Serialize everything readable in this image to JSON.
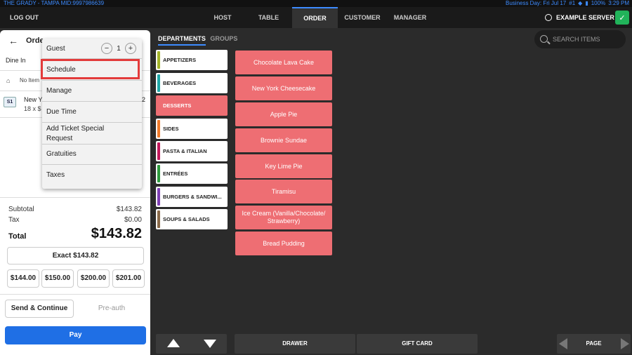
{
  "status_bar": {
    "left": "THE GRADY - TAMPA  MID:9997986639",
    "business_day": "Business Day: Fri Jul 17",
    "number": "#1",
    "battery": "100%",
    "time": "3:29 PM"
  },
  "nav": {
    "logout": "LOG OUT",
    "tabs": [
      {
        "label": "HOST"
      },
      {
        "label": "TABLE"
      },
      {
        "label": "ORDER"
      },
      {
        "label": "CUSTOMER"
      },
      {
        "label": "MANAGER"
      }
    ],
    "active_tab": "ORDER",
    "server_name": "EXAMPLE SERVER"
  },
  "order_panel": {
    "title": "Orde",
    "dine_in": "Dine In",
    "no_item": "No Item",
    "seat": "S1",
    "item_name": "New Y",
    "item_qty": "18 x $",
    "item_price": "2",
    "subtotal_label": "Subtotal",
    "subtotal_value": "$143.82",
    "tax_label": "Tax",
    "tax_value": "$0.00",
    "total_label": "Total",
    "total_value": "$143.82",
    "exact_label": "Exact $143.82",
    "quick_amounts": [
      "$144.00",
      "$150.00",
      "$200.00",
      "$201.00"
    ],
    "send_label": "Send & Continue",
    "preauth_label": "Pre-auth",
    "pay_label": "Pay"
  },
  "menu": {
    "guest_label": "Guest",
    "guest_count": "1",
    "items": [
      "Schedule",
      "Manage",
      "Due Time",
      "Add Ticket Special Request",
      "Gratuities",
      "Taxes"
    ]
  },
  "departments": {
    "tab_active": "DEPARTMENTS",
    "tab_inactive": "GROUPS",
    "list": [
      {
        "label": "APPETIZERS",
        "color": "#a4b52a"
      },
      {
        "label": "BEVERAGES",
        "color": "#1fa7a7"
      },
      {
        "label": "DESSERTS",
        "color": "#ee6e73"
      },
      {
        "label": "SIDES",
        "color": "#f07a2a"
      },
      {
        "label": "PASTA & ITALIAN",
        "color": "#c2185b"
      },
      {
        "label": "ENTRÉES",
        "color": "#2e9b3e"
      },
      {
        "label": "BURGERS & SANDWI...",
        "color": "#7e3fb5"
      },
      {
        "label": "SOUPS & SALADS",
        "color": "#8a6a4a"
      }
    ]
  },
  "items": [
    "Chocolate Lava Cake",
    "New York Cheesecake",
    "Apple Pie",
    "Brownie Sundae",
    "Key Lime Pie",
    "Tiramisu",
    "Ice Cream (Vanilla/Chocolate/ Strawberry)",
    "Bread Pudding"
  ],
  "search": {
    "placeholder": "SEARCH ITEMS"
  },
  "bottom": {
    "drawer": "DRAWER",
    "gift_card": "GIFT CARD",
    "page": "PAGE"
  }
}
